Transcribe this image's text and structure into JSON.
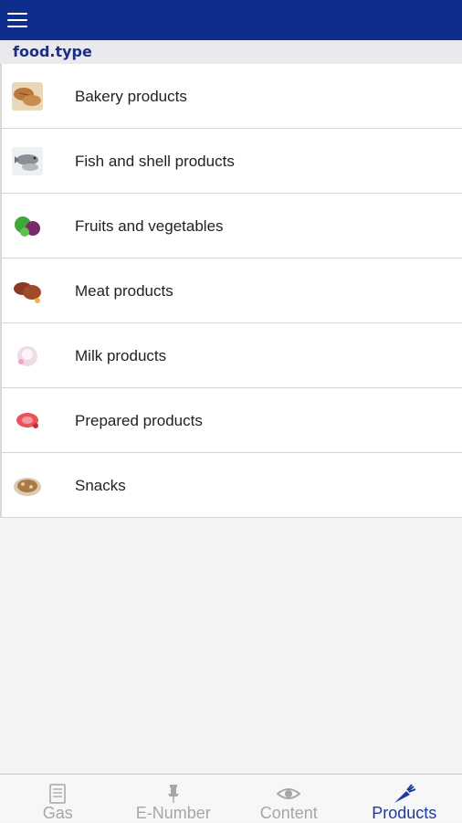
{
  "header": {
    "menu_icon": "hamburger-menu-icon",
    "bar_color": "#0e2d8c"
  },
  "section": {
    "title": "food.type"
  },
  "food_types": [
    {
      "label": "Bakery products",
      "icon": "bread-thumbnail"
    },
    {
      "label": "Fish and shell products",
      "icon": "fish-thumbnail"
    },
    {
      "label": "Fruits and vegetables",
      "icon": "vegetables-thumbnail"
    },
    {
      "label": "Meat products",
      "icon": "meat-thumbnail"
    },
    {
      "label": "Milk products",
      "icon": "milk-thumbnail"
    },
    {
      "label": "Prepared products",
      "icon": "prepared-food-thumbnail"
    },
    {
      "label": "Snacks",
      "icon": "snacks-thumbnail"
    }
  ],
  "tabs": [
    {
      "label": "Gas",
      "icon": "document-list-icon",
      "active": false
    },
    {
      "label": "E-Number",
      "icon": "pin-icon",
      "active": false
    },
    {
      "label": "Content",
      "icon": "eye-icon",
      "active": false
    },
    {
      "label": "Products",
      "icon": "carrot-icon",
      "active": true
    }
  ],
  "colors": {
    "active_tab": "#1f3a9e",
    "inactive_tab": "#a6a6a6"
  }
}
